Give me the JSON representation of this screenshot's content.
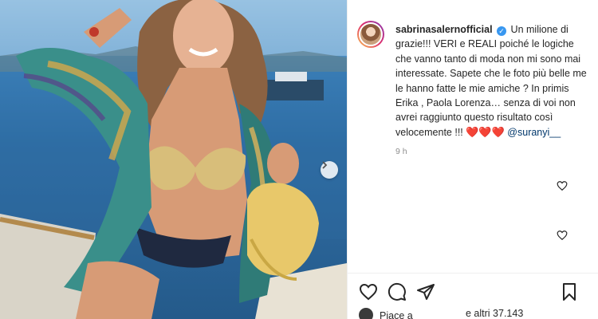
{
  "post": {
    "username": "sabrinasalernofficial",
    "verified_symbol": "✓",
    "caption_text": "Un milione di grazie!!! VERI e REALI poiché le logiche che vanno tanto di moda non mi sono mai interessate. Sapete che le foto più belle me le hanno fatte le mie amiche ? In primis Erika , Paola Lorenza… senza di voi non avrei raggiunto questo risultato così velocemente !!! ",
    "hearts": "❤️❤️❤️",
    "mention": "@suranyi__",
    "timestamp": "9 h"
  },
  "likes": {
    "prefix": "Piace a",
    "suffix": "e altri 37.143"
  },
  "icons": {
    "carousel_next": "chevron-right-icon",
    "like": "heart-outline-icon",
    "comment": "speech-bubble-icon",
    "share": "paper-plane-icon",
    "save": "bookmark-icon"
  },
  "colors": {
    "sea": "#2f6fa6",
    "verified": "#3897f0",
    "mention": "#00376b",
    "heart": "#e0162b",
    "muted": "#8e8e8e"
  }
}
